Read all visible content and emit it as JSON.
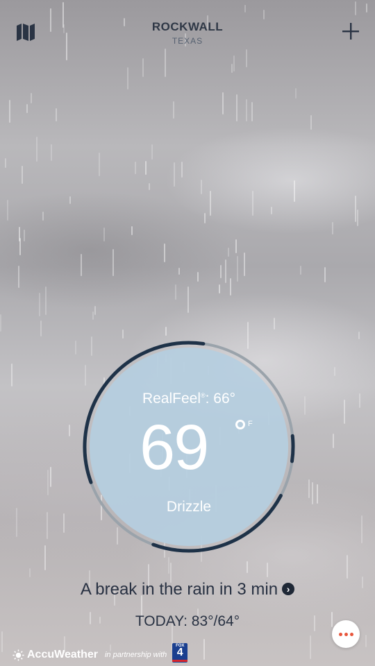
{
  "location": {
    "city": "ROCKWALL",
    "state": "TEXAS"
  },
  "current": {
    "realfeel_label": "RealFeel",
    "realfeel_mark": "®",
    "realfeel_value": ": 66°",
    "temperature": "69",
    "unit": "F",
    "condition": "Drizzle"
  },
  "minutecast": {
    "text": "A break in the rain in 3 min",
    "chevron": "›"
  },
  "today": {
    "text": "TODAY: 83°/64°"
  },
  "footer": {
    "brand": "AccuWeather",
    "partner_text": "in partnership with",
    "partner_logo_text": "FOX",
    "partner_logo_number": "4"
  },
  "icons": {
    "map": "map-icon",
    "add": "plus-icon",
    "more": "more-dots-icon",
    "chevron": "chevron-right-icon"
  },
  "colors": {
    "dial_fill": "#b5cee0",
    "dial_arc_dark": "#1e3248",
    "dial_arc_light": "#9aa3ab",
    "text_dark": "#283142",
    "more_dots": "#e8563c"
  }
}
